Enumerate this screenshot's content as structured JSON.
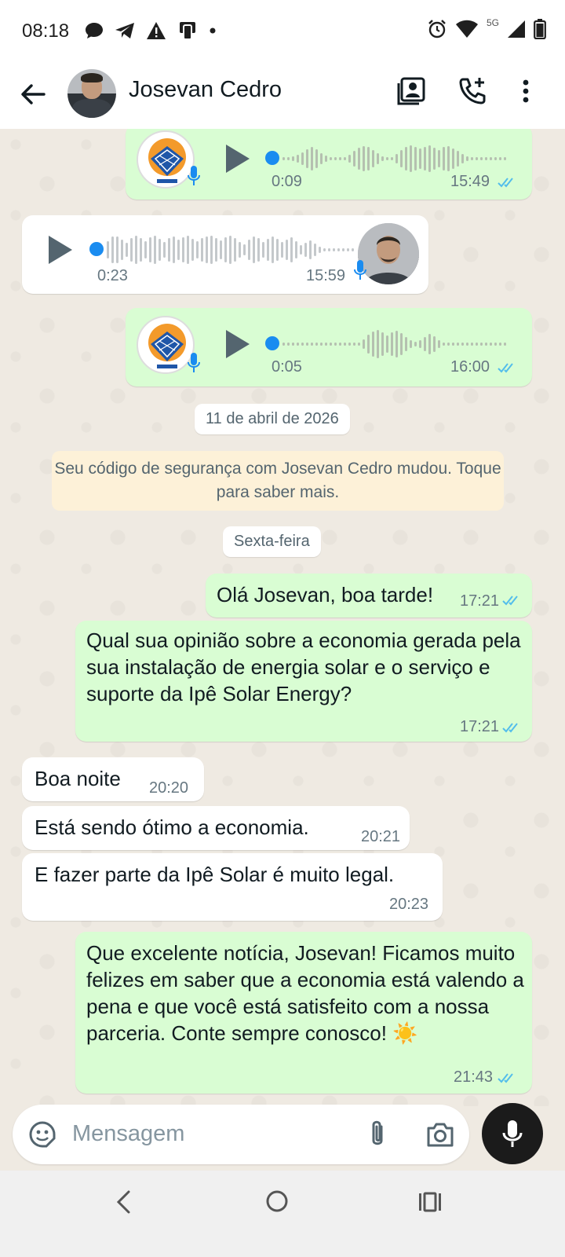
{
  "status_bar": {
    "time": "08:18",
    "network": "5G"
  },
  "header": {
    "contact_name": "Josevan Cedro"
  },
  "messages": {
    "voice1": {
      "duration": "0:09",
      "time": "15:49"
    },
    "voice2": {
      "duration": "0:23",
      "time": "15:59"
    },
    "voice3": {
      "duration": "0:05",
      "time": "16:00"
    },
    "date_divider_1": "11 de abril de 2026",
    "security_notice": "Seu código de segurança com Josevan Cedro mudou. Toque para saber mais.",
    "date_divider_2": "Sexta-feira",
    "m1": {
      "text": "Olá Josevan, boa tarde!",
      "time": "17:21"
    },
    "m2": {
      "text": "Qual sua opinião sobre a economia gerada pela sua instalação de energia solar e o serviço e suporte da Ipê Solar Energy?",
      "time": "17:21"
    },
    "m3": {
      "text": "Boa noite",
      "time": "20:20"
    },
    "m4": {
      "text": "Está sendo ótimo a economia.",
      "time": "20:21"
    },
    "m5": {
      "text": "E fazer parte da Ipê Solar é muito legal.",
      "time": "20:23"
    },
    "m6": {
      "text": "Que excelente notícia, Josevan! Ficamos muito felizes em saber que a economia está valendo a pena e que você está satisfeito com a nossa parceria. Conte sempre conosco! ☀️",
      "time": "21:43"
    }
  },
  "composer": {
    "placeholder": "Mensagem"
  },
  "colors": {
    "outgoing": "#d9fdd3",
    "incoming": "#ffffff",
    "read_ticks": "#53bdeb",
    "accent_blue": "#1a8cf0"
  }
}
